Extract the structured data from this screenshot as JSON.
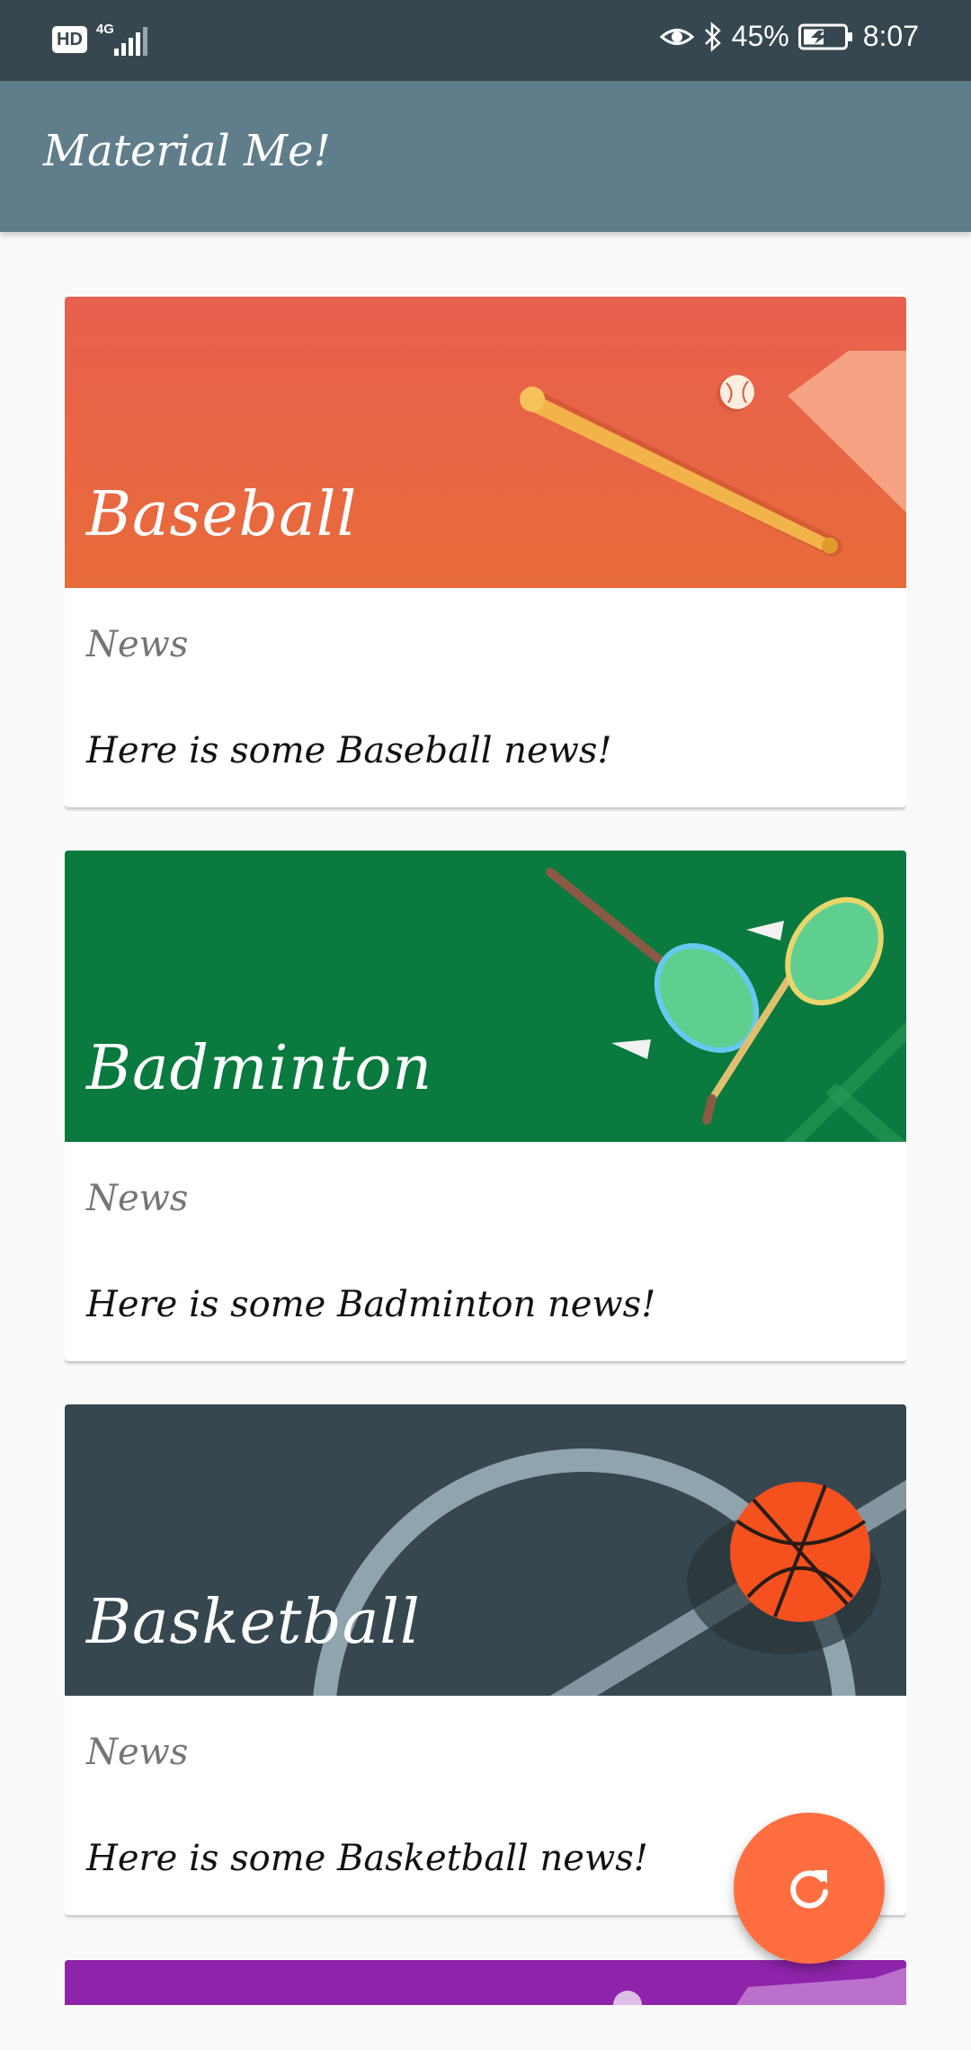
{
  "status_bar": {
    "hd": "HD",
    "network": "4G",
    "battery_percent": "45%",
    "time": "8:07",
    "icons": [
      "hd-icon",
      "signal-icon",
      "eye-comfort-icon",
      "bluetooth-icon",
      "battery-charging-icon"
    ]
  },
  "app_bar": {
    "title": "Material Me!"
  },
  "cards": [
    {
      "title": "Baseball",
      "subtitle": "News",
      "info": "Here is some Baseball news!",
      "image": "baseball-image"
    },
    {
      "title": "Badminton",
      "subtitle": "News",
      "info": "Here is some Badminton news!",
      "image": "badminton-image"
    },
    {
      "title": "Basketball",
      "subtitle": "News",
      "info": "Here is some Basketball news!",
      "image": "basketball-image"
    }
  ],
  "fab": {
    "icon": "refresh-icon",
    "color": "#ff6e40"
  },
  "colors": {
    "status_bar": "#37474f",
    "app_bar": "#607d8b",
    "baseball_bg": "#e8664a",
    "badminton_bg": "#0a7a3e",
    "basketball_bg": "#37474f",
    "next_card_bg": "#8e24aa"
  }
}
